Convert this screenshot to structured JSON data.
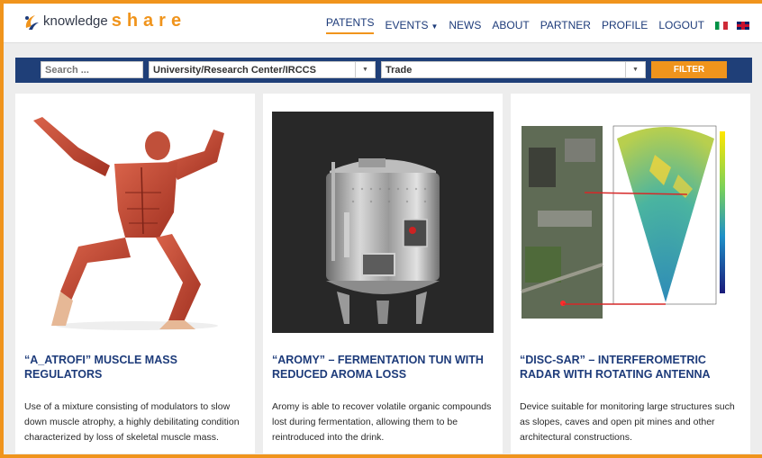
{
  "brand": {
    "name_part1": "knowledge",
    "name_part2": "share",
    "accent_color": "#f0941c",
    "nav_color": "#1d3b7a"
  },
  "nav": {
    "items": [
      {
        "label": "PATENTS",
        "active": true
      },
      {
        "label": "EVENTS",
        "has_dropdown": true
      },
      {
        "label": "NEWS"
      },
      {
        "label": "ABOUT"
      },
      {
        "label": "PARTNER"
      },
      {
        "label": "PROFILE"
      },
      {
        "label": "LOGOUT"
      }
    ],
    "languages": [
      "italian-flag-icon",
      "uk-flag-icon"
    ]
  },
  "filters": {
    "search_placeholder": "Search ...",
    "institution_value": "University/Research Center/IRCCS",
    "category_value": "Trade",
    "button_label": "FILTER"
  },
  "cards": [
    {
      "title": "“A_ATROFI” MUSCLE MASS REGULATORS",
      "description": "Use of a mixture consisting of modulators to slow down muscle atrophy, a highly debilitating condition characterized by loss of skeletal muscle mass.",
      "image_icon": "muscle-anatomy-image"
    },
    {
      "title": "“AROMY” – FERMENTATION TUN WITH REDUCED AROMA LOSS",
      "description": "Aromy is able to recover volatile organic compounds lost during fermentation, allowing them to be reintroduced into the drink.",
      "image_icon": "fermentation-tank-image"
    },
    {
      "title": "“DISC-SAR” – INTERFEROMETRIC RADAR WITH ROTATING ANTENNA",
      "description": "Device suitable for monitoring large structures such as slopes, caves and open pit mines and other architectural constructions.",
      "image_icon": "radar-map-image"
    }
  ]
}
